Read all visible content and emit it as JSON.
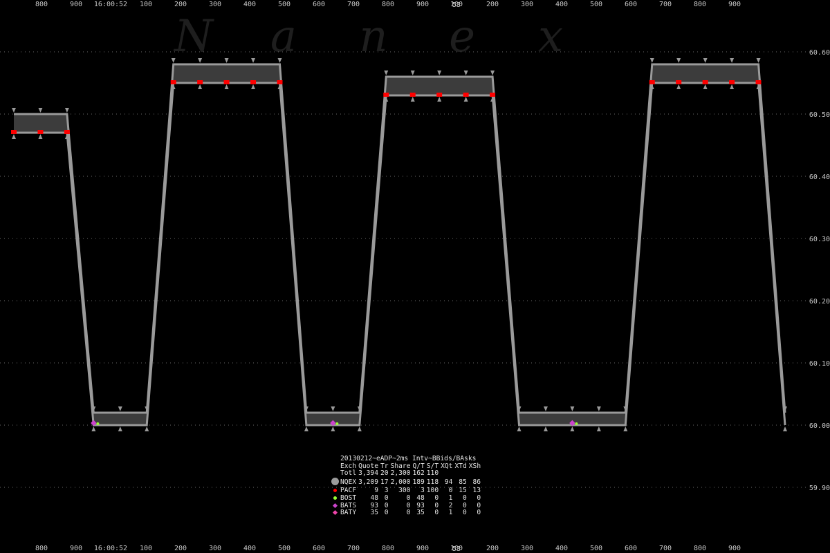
{
  "watermark": [
    "N",
    "a",
    "n",
    "e",
    "x"
  ],
  "top_axis": {
    "left_ticks": [
      "800",
      "900"
    ],
    "time_label": "16:00:52",
    "right_ticks": [
      "100",
      "200",
      "300",
      "400",
      "500",
      "600",
      "700",
      "800",
      "900",
      "100",
      "200",
      "300",
      "400",
      "500",
      "600",
      "700",
      "800",
      "900"
    ],
    "second_label": "53"
  },
  "price_axis": {
    "ticks": [
      "60.60",
      "60.50",
      "60.40",
      "60.30",
      "60.20",
      "60.10",
      "60.00",
      "59.90"
    ]
  },
  "colors": {
    "spread": "#3c3c3c",
    "quote_markers": "#9a9a9a",
    "pacf": "#ff0000",
    "bost": "#99ff33",
    "bats": "#cc44cc",
    "baty": "#ee44aa"
  },
  "chart_data": {
    "type": "area",
    "title": "20130212~eADP~2ms Intv~BBids/BAsks",
    "ylabel": "",
    "ylim": [
      59.86,
      60.64
    ],
    "y_ticks": [
      60.6,
      60.5,
      60.4,
      60.3,
      60.2,
      60.1,
      60.0,
      59.9
    ],
    "grid": true,
    "series": [
      {
        "name": "Asks",
        "values": [
          60.5,
          60.5,
          60.5,
          60.02,
          60.02,
          60.02,
          60.58,
          60.58,
          60.58,
          60.58,
          60.58,
          60.02,
          60.02,
          60.02,
          60.56,
          60.56,
          60.56,
          60.56,
          60.56,
          60.02,
          60.02,
          60.02,
          60.02,
          60.02,
          60.58,
          60.58,
          60.58,
          60.58,
          60.58,
          60.02
        ]
      },
      {
        "name": "Bids",
        "values": [
          60.47,
          60.47,
          60.47,
          60.0,
          60.0,
          60.0,
          60.55,
          60.55,
          60.55,
          60.55,
          60.55,
          60.0,
          60.0,
          60.0,
          60.53,
          60.53,
          60.53,
          60.53,
          60.53,
          60.0,
          60.0,
          60.0,
          60.0,
          60.0,
          60.55,
          60.55,
          60.55,
          60.55,
          60.55,
          60.0
        ]
      }
    ],
    "stats_table": {
      "columns": [
        "Exch",
        "Quote",
        "Tr",
        "Share",
        "Q/T",
        "S/T",
        "XQt",
        "XTd",
        "XSh"
      ],
      "rows": [
        {
          "marker": "",
          "cells": [
            "Totl",
            "3,394",
            "20",
            "2,300",
            "162",
            "110",
            "",
            "",
            ""
          ]
        },
        {
          "marker": "nqex",
          "cells": [
            "NQEX",
            "3,209",
            "17",
            "2,000",
            "189",
            "118",
            "94",
            "85",
            "86"
          ]
        },
        {
          "marker": "pacf",
          "cells": [
            "PACF",
            "9",
            "3",
            "300",
            "3",
            "100",
            "0",
            "15",
            "13"
          ]
        },
        {
          "marker": "bost",
          "cells": [
            "BOST",
            "48",
            "0",
            "0",
            "48",
            "0",
            "1",
            "0",
            "0"
          ]
        },
        {
          "marker": "bats",
          "cells": [
            "BATS",
            "93",
            "0",
            "0",
            "93",
            "0",
            "2",
            "0",
            "0"
          ]
        },
        {
          "marker": "baty",
          "cells": [
            "BATY",
            "35",
            "0",
            "0",
            "35",
            "0",
            "1",
            "0",
            "0"
          ]
        }
      ]
    }
  }
}
